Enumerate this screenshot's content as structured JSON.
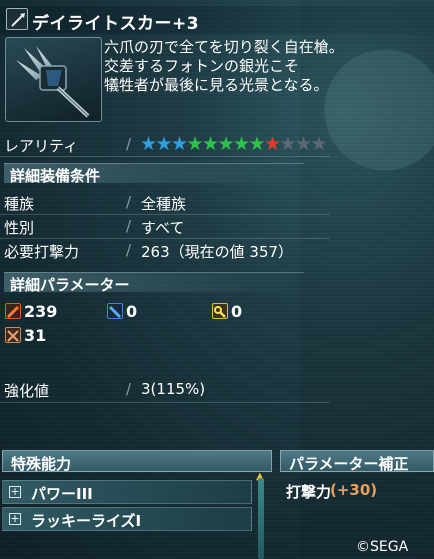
{
  "item": {
    "name": "デイライトスカー+3",
    "description": [
      "六爪の刃で全てを切り裂く自在槍。",
      "交差するフォトンの銀光こそ",
      "犠牲者が最後に見る光景となる。"
    ]
  },
  "rarity": {
    "label": "レアリティ",
    "stars_filled": 9,
    "stars_total": 12,
    "star_colors": [
      "#2f9fe0",
      "#2f9fe0",
      "#2f9fe0",
      "#2fc24a",
      "#2fc24a",
      "#2fc24a",
      "#2fc24a",
      "#2fc24a",
      "#e23a2a",
      "#5a6a70",
      "#5a6a70",
      "#5a6a70"
    ]
  },
  "requirements": {
    "header": "詳細装備条件",
    "rows": [
      {
        "label": "種族",
        "value": "全種族"
      },
      {
        "label": "性別",
        "value": "すべて"
      },
      {
        "label": "必要打撃力",
        "value": "263（現在の値 357）"
      }
    ]
  },
  "parameters": {
    "header": "詳細パラメーター",
    "items": [
      {
        "icon": "striking-attack-icon",
        "value": "239",
        "color": "#e05a2a"
      },
      {
        "icon": "ranged-attack-icon",
        "value": "0",
        "color": "#3a8ae0"
      },
      {
        "icon": "technique-attack-icon",
        "value": "0",
        "color": "#e0c030"
      },
      {
        "icon": "defense-icon",
        "value": "31",
        "color": "#d08a5a"
      }
    ]
  },
  "enhancement": {
    "label": "強化値",
    "value": "3(115%)"
  },
  "special_abilities": {
    "header": "特殊能力",
    "items": [
      "パワーIII",
      "ラッキーライズI"
    ]
  },
  "param_bonus": {
    "header": "パラメーター補正",
    "label": "打撃力",
    "value": "(+30)"
  },
  "copyright": "©SEGA"
}
